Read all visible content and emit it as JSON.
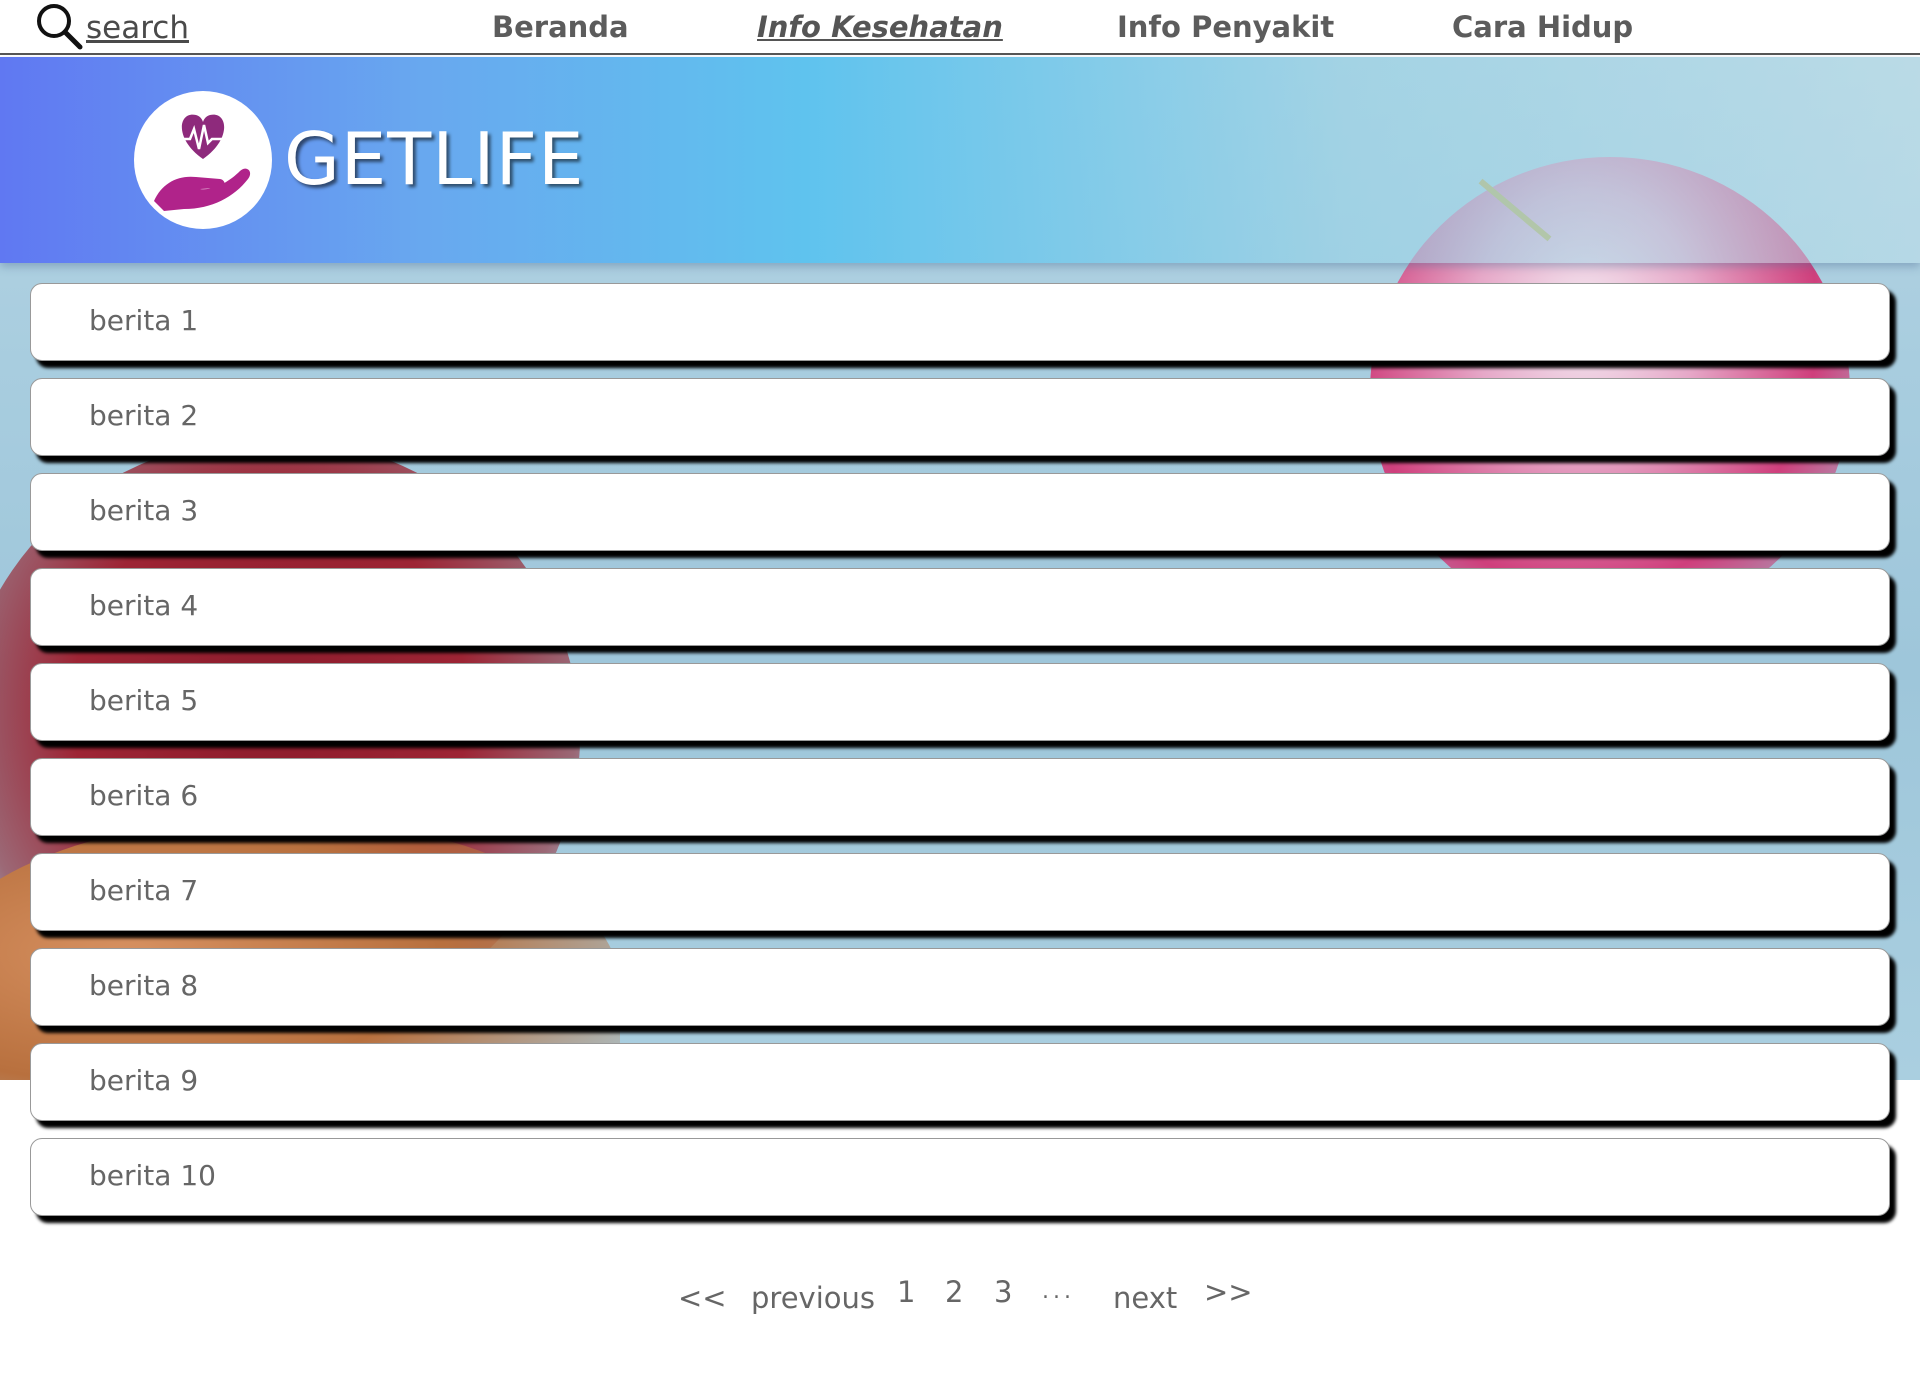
{
  "nav": {
    "search_label": "search",
    "items": [
      {
        "label": "Beranda",
        "active": false
      },
      {
        "label": "Info Kesehatan",
        "active": true
      },
      {
        "label": "Info Penyakit",
        "active": false
      },
      {
        "label": "Cara Hidup",
        "active": false
      }
    ]
  },
  "banner": {
    "brand": "GETLIFE",
    "logo_icon": "heart-hand-icon",
    "logo_color": "#8e2a7c"
  },
  "news": [
    {
      "title": "berita 1"
    },
    {
      "title": "berita 2"
    },
    {
      "title": "berita 3"
    },
    {
      "title": "berita 4"
    },
    {
      "title": "berita 5"
    },
    {
      "title": "berita 6"
    },
    {
      "title": "berita 7"
    },
    {
      "title": "berita 8"
    },
    {
      "title": "berita 9"
    },
    {
      "title": "berita 10"
    }
  ],
  "pagination": {
    "first": "<<",
    "previous": "previous",
    "pages": [
      "1",
      "2",
      "3"
    ],
    "ellipsis": "...",
    "next": "next",
    "last": ">>"
  }
}
